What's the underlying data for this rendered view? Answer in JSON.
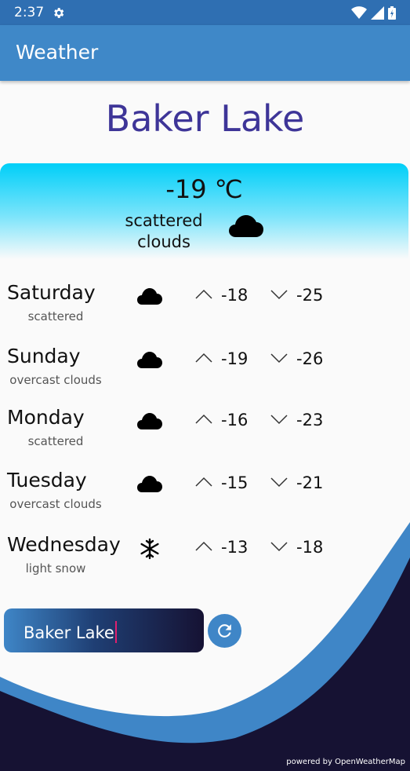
{
  "status_bar": {
    "time": "2:37"
  },
  "app_bar": {
    "title": "Weather"
  },
  "city": "Baker Lake",
  "current": {
    "temp": "-19 ℃",
    "description_line1": "scattered",
    "description_line2": "clouds",
    "icon": "cloud-icon"
  },
  "forecast": [
    {
      "day": "Saturday",
      "desc": "scattered",
      "icon": "cloud-icon",
      "high": "-18",
      "low": "-25"
    },
    {
      "day": "Sunday",
      "desc": "overcast clouds",
      "icon": "cloud-icon",
      "high": "-19",
      "low": "-26"
    },
    {
      "day": "Monday",
      "desc": "scattered",
      "icon": "cloud-icon",
      "high": "-16",
      "low": "-23"
    },
    {
      "day": "Tuesday",
      "desc": "overcast clouds",
      "icon": "cloud-icon",
      "high": "-15",
      "low": "-21"
    },
    {
      "day": "Wednesday",
      "desc": "light snow",
      "icon": "snowflake-icon",
      "high": "-13",
      "low": "-18"
    }
  ],
  "search": {
    "value": "Baker Lake"
  },
  "footer": {
    "powered_by": "powered by OpenWeatherMap"
  },
  "colors": {
    "appbar": "#3f88c8",
    "statusbar": "#2f6fb2",
    "city_text": "#3e3598",
    "wave_light": "#3f86c7",
    "wave_dark": "#161233",
    "caret": "#e0206e"
  }
}
